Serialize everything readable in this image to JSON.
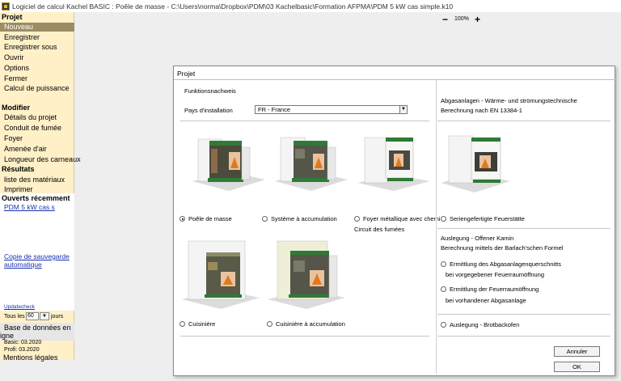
{
  "window": {
    "title": "Logiciel de calcul Kachel BASIC : Poêle de masse - C:\\Users\\norma\\Dropbox\\PDM\\03 Kachelbasic\\Formation AFPMA\\PDM 5 kW cas simple.k10"
  },
  "sidebar": {
    "projet_heading": "Projet",
    "projet_items": [
      "Nouveau",
      "Enregistrer",
      "Enregistrer sous",
      "Ouvrir",
      "Options",
      "Fermer",
      "Calcul de puissance"
    ],
    "modifier_heading": "Modifier",
    "modifier_items": [
      "Détails du projet",
      "Conduit de fumée",
      "Foyer",
      "Amenée d'air",
      "Longueur des carneaux"
    ],
    "resultats_heading": "Résultats",
    "resultats_items": [
      "liste des matériaux",
      "Imprimer"
    ],
    "recent_heading": "Ouverts récemment",
    "recent_file": "PDM 5 kW cas s",
    "backup_link_line1": "Copie de sauvegarde",
    "backup_link_line2": "automatique",
    "updatecheck": "Updatecheck",
    "tous_les": "Tous les",
    "days_value": "60",
    "jours": "jours",
    "database_line1": "Base de données en",
    "database_line2": "igne",
    "basic_version": "Basic: 03.2020",
    "profi_version": "Profi: 03.2020",
    "mentions": "Mentions légales"
  },
  "zoom": {
    "minus": "−",
    "level": "100%",
    "plus": "+"
  },
  "dialog": {
    "title": "Projet",
    "funktionsnachweis": "Funktionsnachweis",
    "country_label": "Pays d'installation",
    "country_value": "FR - France",
    "options": {
      "poele": "Poêle de masse",
      "systeme": "Système à accumulation",
      "foyer": "Foyer métallique avec chemi",
      "circuit": "Circuit des fumées",
      "cuisiniere": "Cuisinière",
      "cuisiniere_acc": "Cuisinière à accumulation"
    },
    "right": {
      "abgas_line1": "Abgasanlagen - Wärme- und strömungstechnische",
      "abgas_line2": "Berechnung nach EN 13384-1",
      "serien": "Seriengefertigte Feuerstätte",
      "auslegung_kamin": "Auslegung - Offener Kamin",
      "barlach": "Berechnung mittels der Barlach'schen Formel",
      "ermittlung1_line1": "Ermittlung des Abgasanlagenquerschnitts",
      "ermittlung1_line2": "bei vorgegebener Feuerraumöffnung",
      "ermittlung2_line1": "Ermittlung der Feuerraumöffnung",
      "ermittlung2_line2": "bei vorhandener Abgasanlage",
      "brotbackofen": "Auslegung - Brotbackofen"
    },
    "cancel": "Annuler",
    "ok": "OK"
  },
  "colors": {
    "sidebar_bg": "#fff0c8",
    "active_item": "#9b8c63",
    "link": "#1a2fb0",
    "stove_green": "#2f7a36",
    "fire": "#e07a1e"
  }
}
